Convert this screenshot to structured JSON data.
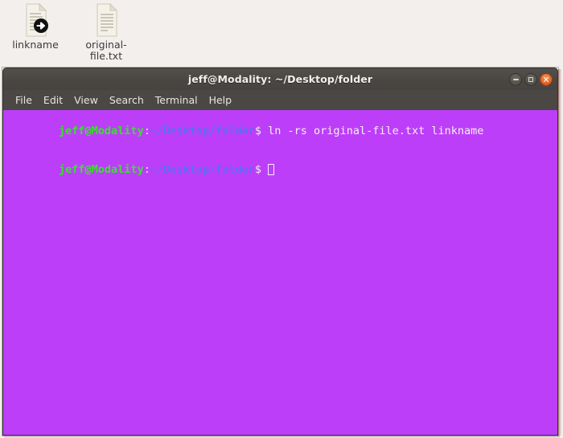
{
  "desktop": {
    "background_color": "#f2efec",
    "icons": [
      {
        "label": "linkname",
        "icon": "document-symlink-icon",
        "badge": "symlink-arrow-badge"
      },
      {
        "label": "original-file.txt",
        "icon": "text-document-icon",
        "badge": ""
      }
    ]
  },
  "terminal": {
    "title": "jeff@Modality: ~/Desktop/folder",
    "titlebar_color": "#4a4743",
    "background_color": "#bd3ef9",
    "window_controls": [
      {
        "name": "minimize",
        "glyph": "–"
      },
      {
        "name": "maximize",
        "glyph": "□"
      },
      {
        "name": "close",
        "glyph": "✕",
        "color": "#e4652a"
      }
    ],
    "menu": [
      {
        "label": "File"
      },
      {
        "label": "Edit"
      },
      {
        "label": "View"
      },
      {
        "label": "Search"
      },
      {
        "label": "Terminal"
      },
      {
        "label": "Help"
      }
    ],
    "prompt": {
      "user_host": "jeff@Modality",
      "separator": ":",
      "path": "~/Desktop/folder",
      "sigil": "$",
      "user_host_color": "#31e722",
      "path_color": "#5b6ef0"
    },
    "lines": [
      {
        "type": "prompt",
        "command": " ln -rs original-file.txt linkname"
      },
      {
        "type": "prompt",
        "command": " ",
        "cursor": true
      }
    ]
  }
}
